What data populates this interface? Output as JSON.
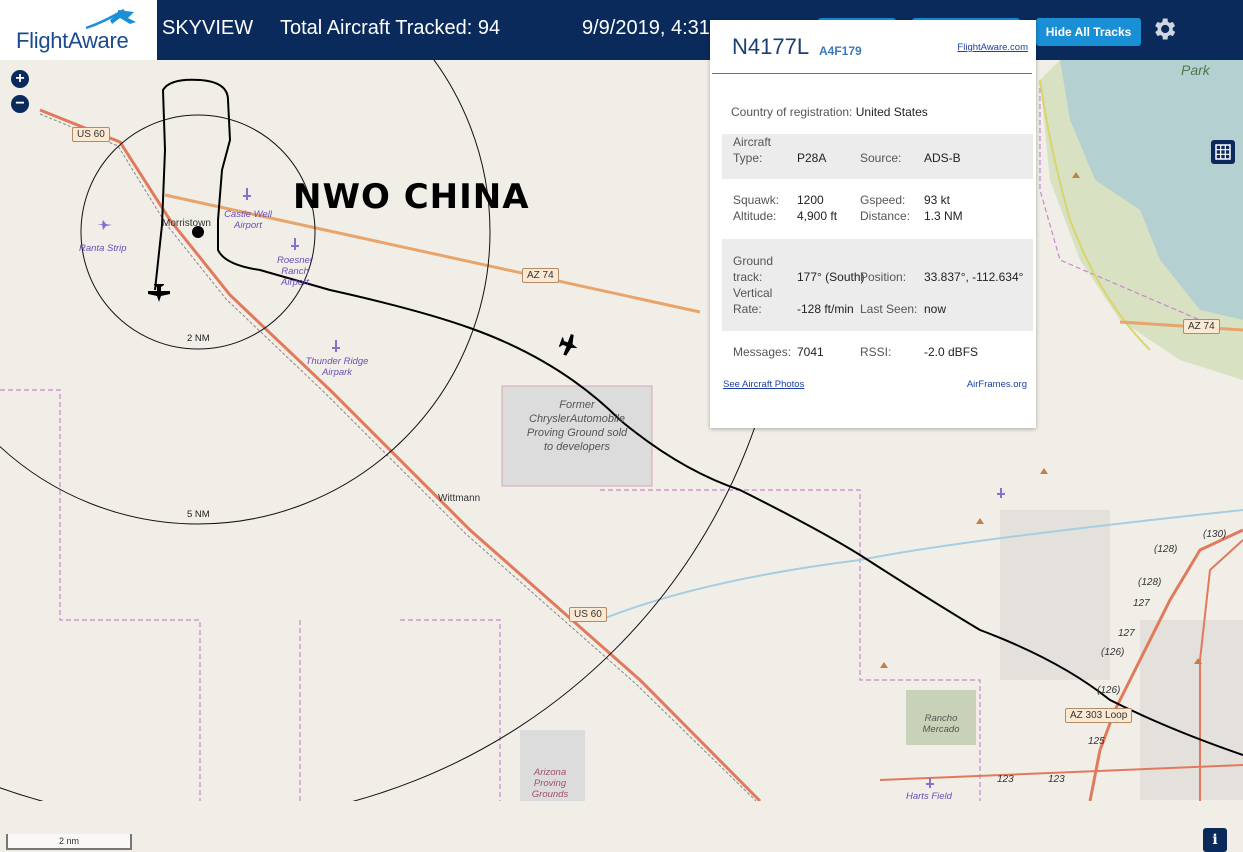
{
  "header": {
    "logo": "FlightAware",
    "app_name": "SKYVIEW",
    "aircraft_tracked": "Total Aircraft Tracked: 94",
    "datetime": "9/9/2019, 4:31",
    "hide_tracks_label": "Hide All Tracks"
  },
  "map": {
    "overlay_text": "NWO CHINA",
    "places": [
      "Morristown",
      "Wittmann"
    ],
    "airports": [
      "Ranta Strip",
      "Castle Well Airport",
      "Roesner Ranch Airport",
      "Thunder Ridge Airpark",
      "Harts Field"
    ],
    "landmarks": [
      "Former ChryslerAutomobile Proving Ground sold to developers",
      "Rancho Mercado",
      "Arizona Proving Grounds",
      "Park"
    ],
    "roads": [
      "US 60",
      "AZ 74",
      "AZ 74",
      "US 60",
      "AZ 303 Loop",
      "(128)",
      "(130)",
      "(128)",
      "127",
      "127",
      "(126)",
      "(126)",
      "125",
      "123",
      "123"
    ],
    "range_rings": [
      "2 NM",
      "5 NM"
    ],
    "scale": "2 nm",
    "zoom_in": "+",
    "zoom_out": "−",
    "info": "i"
  },
  "popup": {
    "callsign": "N4177L",
    "hex": "A4F179",
    "site_link": "FlightAware.com",
    "country_label": "Country of registration:",
    "country_value": "United States",
    "aircraft_type_label": "Aircraft Type:",
    "aircraft_type_value": "P28A",
    "source_label": "Source:",
    "source_value": "ADS-B",
    "squawk_label": "Squawk:",
    "squawk_value": "1200",
    "gspeed_label": "Gspeed:",
    "gspeed_value": "93 kt",
    "altitude_label": "Altitude:",
    "altitude_value": "4,900 ft",
    "distance_label": "Distance:",
    "distance_value": "1.3 NM",
    "track_label": "Ground track:",
    "track_value": "177° (South)",
    "position_label": "Position:",
    "position_value": "33.837°, -112.634°",
    "vrate_label": "Vertical Rate:",
    "vrate_value": "-128 ft/min",
    "lastseen_label": "Last Seen:",
    "lastseen_value": "now",
    "messages_label": "Messages:",
    "messages_value": "7041",
    "rssi_label": "RSSI:",
    "rssi_value": "-2.0 dBFS",
    "photos_link": "See Aircraft Photos",
    "airframes_link": "AirFrames.org"
  },
  "colors": {
    "header_bg": "#0a2a5c",
    "button_blue": "#1a8fd6",
    "highway_orange": "#e8a46a",
    "us60_red": "#e17a5c",
    "water": "#b5d0d0",
    "boundary_purple": "#c58ac8",
    "park_green": "#c8d9a8"
  }
}
